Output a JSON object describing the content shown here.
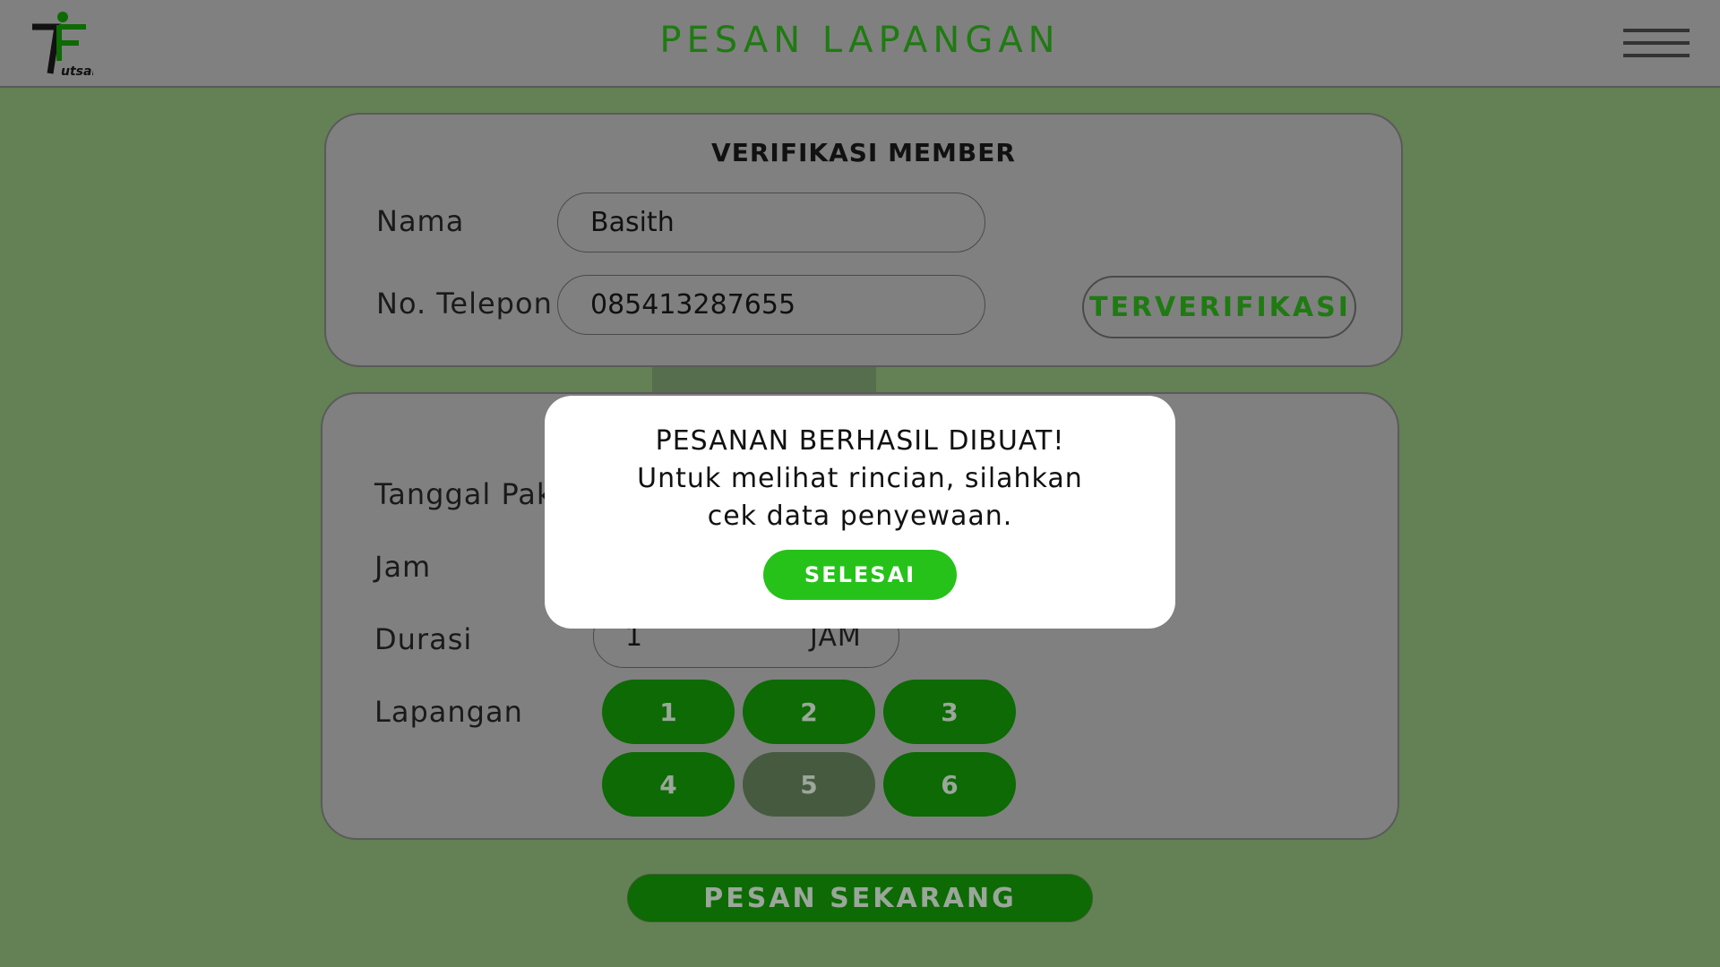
{
  "header": {
    "title": "PESAN LAPANGAN",
    "logo_text": "7Futsal",
    "logo_small_text": "utsal",
    "menu_icon": "hamburger-icon"
  },
  "verification": {
    "title": "VERIFIKASI MEMBER",
    "name_label": "Nama",
    "name_value": "Basith",
    "phone_label": "No. Telepon",
    "phone_value": "085413287655",
    "status_button": "TERVERIFIKASI"
  },
  "booking": {
    "date_label": "Tanggal Pak",
    "time_label": "Jam",
    "duration_label": "Durasi",
    "duration_value": "1",
    "duration_unit": "JAM",
    "court_label": "Lapangan",
    "courts": [
      {
        "label": "1",
        "available": true
      },
      {
        "label": "2",
        "available": true
      },
      {
        "label": "3",
        "available": true
      },
      {
        "label": "4",
        "available": true
      },
      {
        "label": "5",
        "available": false
      },
      {
        "label": "6",
        "available": true
      }
    ],
    "order_button": "PESAN SEKARANG"
  },
  "modal": {
    "line1": "PESANAN BERHASIL DIBUAT!",
    "line2": "Untuk melihat rincian, silahkan",
    "line3": "cek data penyewaan.",
    "button": "SELESAI"
  },
  "colors": {
    "background": "#648055",
    "header": "#808080",
    "accent_green": "#1f7a12",
    "button_green": "#0d6a04",
    "modal_button": "#26c21a"
  }
}
